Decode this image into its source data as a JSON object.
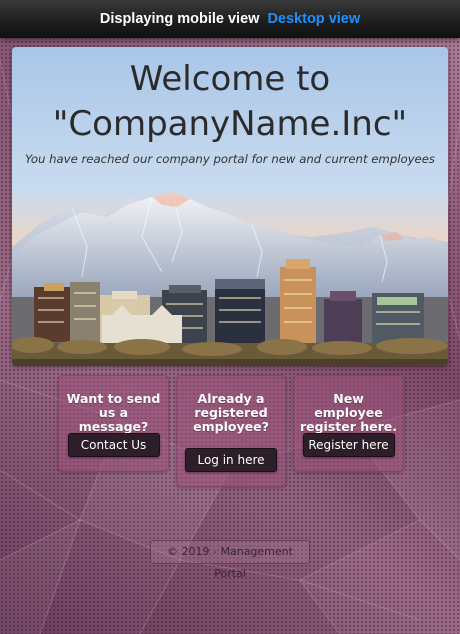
{
  "topbar": {
    "mobile_label": "Displaying mobile view",
    "desktop_link": "Desktop view"
  },
  "hero": {
    "title_line1": "Welcome to",
    "title_line2": "\"CompanyName.Inc\"",
    "subtitle": "You have reached our company portal for new and current employees"
  },
  "cards": {
    "contact": {
      "text": "Want to send us a message?",
      "button": "Contact Us"
    },
    "login": {
      "text": "Already a registered employee?",
      "button": "Log in here"
    },
    "register": {
      "text": "New employee register here.",
      "button": "Register here"
    }
  },
  "footer": {
    "text": "© 2019 - Management Portal"
  },
  "colors": {
    "link": "#1e90ff",
    "button_bg": "#2c1f2a",
    "card_bg": "#9b5078",
    "page_bg": "#7e4a6a"
  }
}
